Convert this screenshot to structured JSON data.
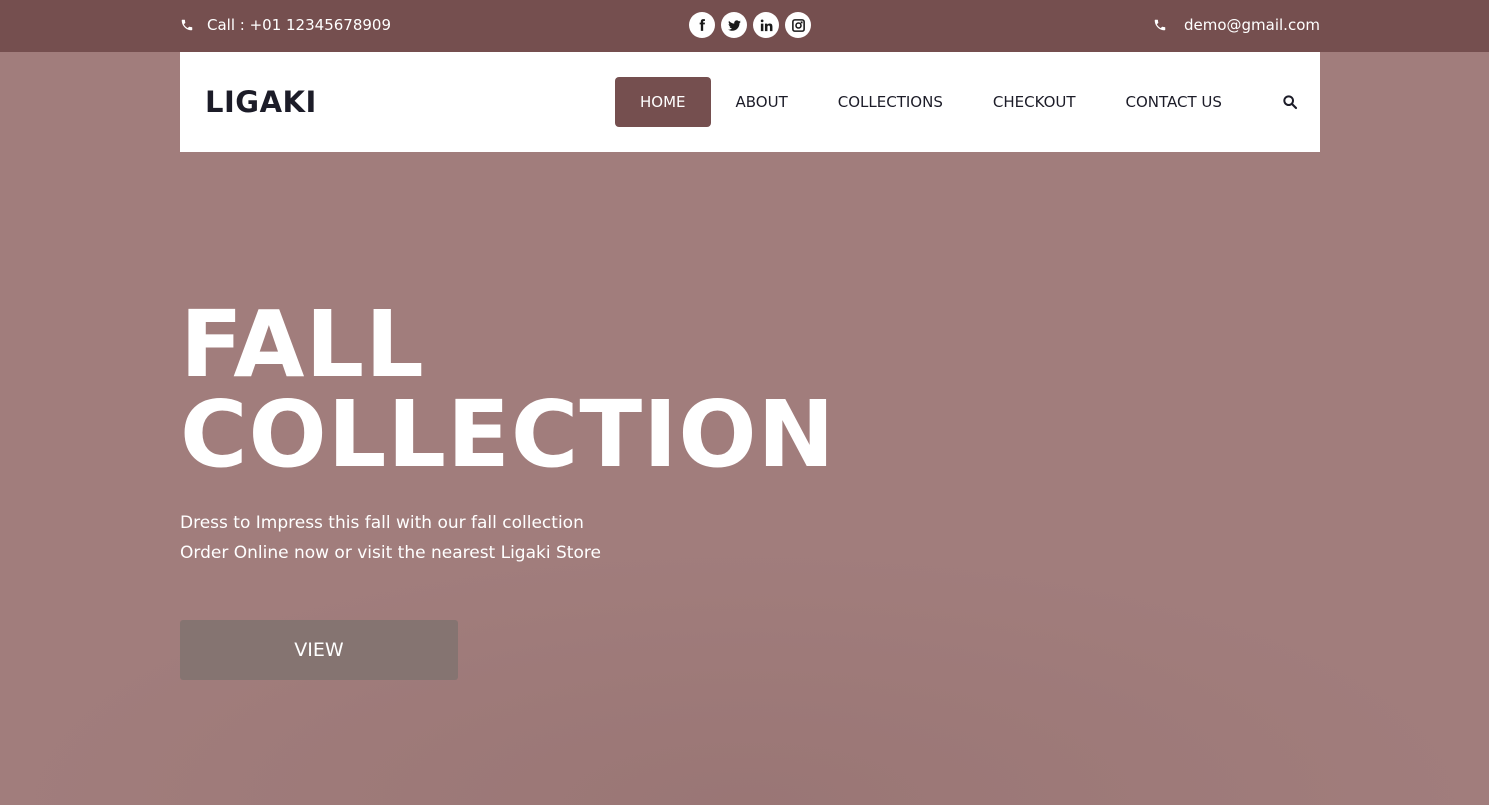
{
  "topbar": {
    "phone_text": "Call : +01 12345678909",
    "email_text": "demo@gmail.com",
    "socials": [
      {
        "name": "facebook",
        "glyph": "f"
      },
      {
        "name": "twitter",
        "glyph": "t"
      },
      {
        "name": "linkedin",
        "glyph": "in"
      },
      {
        "name": "instagram",
        "glyph": "ig"
      }
    ]
  },
  "navbar": {
    "logo": "LIGAKI",
    "items": [
      {
        "label": "HOME",
        "active": true
      },
      {
        "label": "ABOUT",
        "active": false
      },
      {
        "label": "COLLECTIONS",
        "active": false
      },
      {
        "label": "CHECKOUT",
        "active": false
      },
      {
        "label": "CONTACT US",
        "active": false
      }
    ]
  },
  "hero": {
    "title_line1": "FALL",
    "title_line2": "COLLECTION",
    "subtitle_line1": "Dress to Impress this fall with our fall collection",
    "subtitle_line2": "Order Online now or visit the nearest Ligaki Store",
    "button_label": "VIEW"
  },
  "colors": {
    "accent": "#754f4f",
    "hero_background": "#a17d7c",
    "button_background": "#857471",
    "text_dark": "#1c1c28"
  }
}
